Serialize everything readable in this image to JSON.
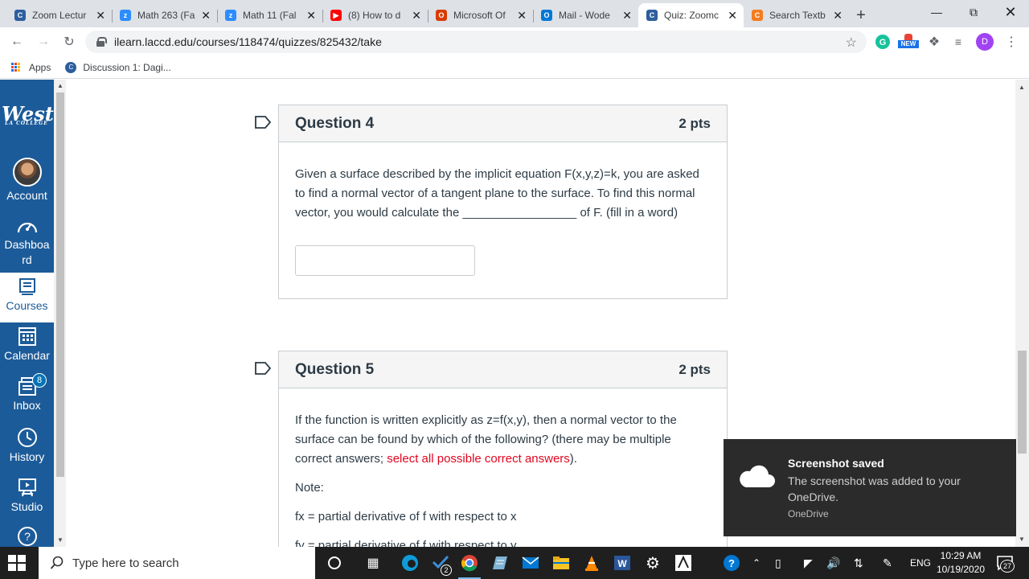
{
  "browser": {
    "tabs": [
      {
        "title": "Zoom Lectur",
        "fav_text": "C",
        "fav_color": "#2d5e9e",
        "active": false
      },
      {
        "title": "Math 263 (Fa",
        "fav_text": "z",
        "fav_color": "#2d8cff",
        "active": false
      },
      {
        "title": "Math 11 (Fal",
        "fav_text": "z",
        "fav_color": "#2d8cff",
        "active": false
      },
      {
        "title": "(8) How to d",
        "fav_text": "▶",
        "fav_color": "#ff0000",
        "active": false
      },
      {
        "title": "Microsoft Of",
        "fav_text": "O",
        "fav_color": "#d83b01",
        "active": false
      },
      {
        "title": "Mail - Wode",
        "fav_text": "O",
        "fav_color": "#0078d4",
        "active": false
      },
      {
        "title": "Quiz: Zoomc",
        "fav_text": "C",
        "fav_color": "#2d5e9e",
        "active": true
      },
      {
        "title": "Search Textb",
        "fav_text": "C",
        "fav_color": "#f47b20",
        "active": false
      }
    ],
    "new_tab": "+",
    "url": "ilearn.laccd.edu/courses/118474/quizzes/825432/take",
    "ext_badge": "NEW",
    "profile_initial": "D",
    "bookmarks": [
      {
        "label": "Apps"
      },
      {
        "label": "Discussion 1: Dagi..."
      }
    ]
  },
  "sidebar": {
    "logo": "West",
    "logo_sub": "LA COLLEGE",
    "items": [
      {
        "label": "Account"
      },
      {
        "label": "Dashboa rd"
      },
      {
        "label": "Courses"
      },
      {
        "label": "Calendar"
      },
      {
        "label": "Inbox",
        "badge": "8"
      },
      {
        "label": "History"
      },
      {
        "label": "Studio"
      }
    ]
  },
  "quiz": {
    "q4": {
      "title": "Question 4",
      "points": "2 pts",
      "text": "Given a surface described by the implicit equation F(x,y,z)=k, you are asked to find a normal vector of a tangent plane to the surface.  To find this normal vector, you would calculate the _________________ of F.  (fill in a word)"
    },
    "q5": {
      "title": "Question 5",
      "points": "2 pts",
      "text_a": "If the function is written explicitly as z=f(x,y), then a normal vector to the surface can be found by which of the following? (there may be multiple correct answers; ",
      "text_red": "select all possible correct answers",
      "text_b": ").",
      "note": "Note:",
      "fx": "fx = partial derivative of f with respect to x",
      "fy": "fy = partial derivative of f with respect to y"
    }
  },
  "toast": {
    "title": "Screenshot saved",
    "body": "The screenshot was added to your OneDrive.",
    "source": "OneDrive"
  },
  "taskbar": {
    "search_placeholder": "Type here to search",
    "vs_badge": "2",
    "language": "ENG",
    "time": "10:29 AM",
    "date": "10/19/2020",
    "notif_count": "27"
  }
}
